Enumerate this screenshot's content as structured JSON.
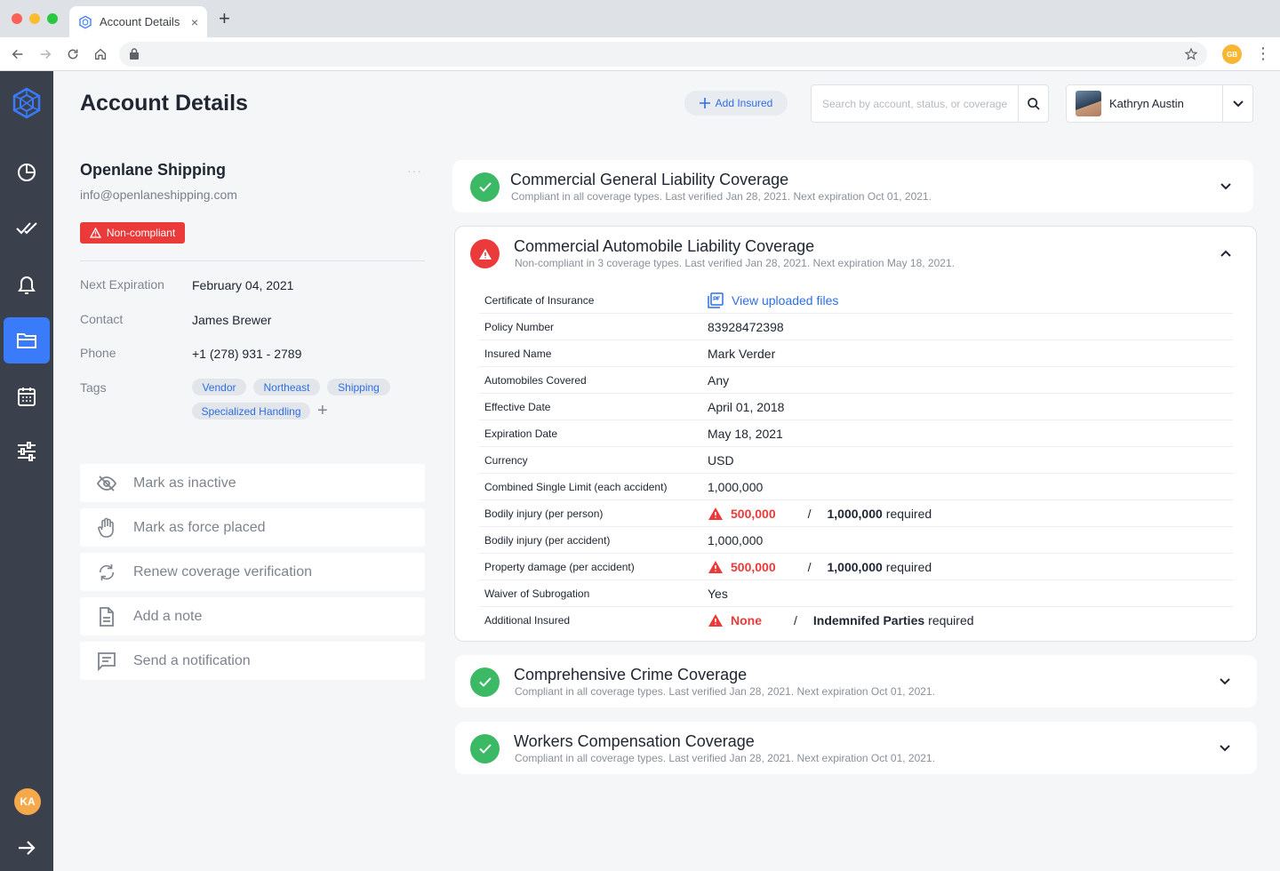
{
  "browser": {
    "tab_title": "Account Details",
    "new_tab": "+",
    "close_tab": "×",
    "ext_avatar": "GB"
  },
  "header": {
    "title": "Account Details",
    "add_insured_label": "Add Insured",
    "search_placeholder": "Search by account, status, or coverage",
    "user_name": "Kathryn Austin"
  },
  "sidebar": {
    "items": [
      "logo-icon",
      "dashboard-icon",
      "tasks-icon",
      "bell-icon",
      "folder-icon",
      "calendar-icon",
      "sliders-icon"
    ],
    "active_index": 4,
    "avatar_initials": "KA",
    "accent": "#3a7bfa"
  },
  "account": {
    "name": "Openlane Shipping",
    "email": "info@openlaneshipping.com",
    "status": "Non-compliant",
    "more": "···",
    "details": [
      {
        "label": "Next Expiration",
        "value": "February 04, 2021"
      },
      {
        "label": "Contact",
        "value": "James Brewer"
      },
      {
        "label": "Phone",
        "value": "+1 (278) 931 - 2789"
      }
    ],
    "tags_label": "Tags",
    "tags": [
      "Vendor",
      "Northeast",
      "Shipping",
      "Specialized Handling"
    ],
    "tag_add": "+"
  },
  "actions": [
    {
      "label": "Mark as inactive",
      "icon": "eye-off-icon"
    },
    {
      "label": "Mark as force placed",
      "icon": "hand-icon"
    },
    {
      "label": "Renew coverage verification",
      "icon": "refresh-icon"
    },
    {
      "label": "Add a note",
      "icon": "note-icon"
    },
    {
      "label": "Send a notification",
      "icon": "message-icon"
    }
  ],
  "coverages": [
    {
      "title": "Commercial General Liability Coverage",
      "subtitle": "Compliant in all coverage types. Last verified Jan 28, 2021. Next expiration Oct 01, 2021.",
      "status": "compliant"
    },
    {
      "title": "Commercial Automobile Liability Coverage",
      "subtitle": "Non-compliant in 3 coverage types. Last verified Jan 28, 2021. Next expiration May 18, 2021.",
      "status": "non-compliant"
    },
    {
      "title": "Comprehensive Crime Coverage",
      "subtitle": "Compliant in all coverage types. Last verified Jan 28, 2021. Next expiration Oct 01, 2021.",
      "status": "compliant"
    },
    {
      "title": "Workers Compensation Coverage",
      "subtitle": "Compliant in all coverage types. Last verified Jan 28, 2021. Next expiration Oct 01, 2021.",
      "status": "compliant"
    }
  ],
  "auto_details": {
    "rows": [
      {
        "label": "Certificate of Insurance",
        "value": "View uploaded files"
      },
      {
        "label": "Policy Number",
        "value": "83928472398"
      },
      {
        "label": "Insured Name",
        "value": "Mark Verder"
      },
      {
        "label": "Automobiles Covered",
        "value": "Any"
      },
      {
        "label": "Effective Date",
        "value": "April 01, 2018"
      },
      {
        "label": "Expiration Date",
        "value": "May 18, 2021"
      },
      {
        "label": "Currency",
        "value": "USD"
      },
      {
        "label": "Combined Single Limit (each accident)",
        "value": "1,000,000"
      },
      {
        "label": "Bodily injury (per person)",
        "value": "500,000",
        "required": "1,000,000"
      },
      {
        "label": "Bodily injury (per accident)",
        "value": "1,000,000"
      },
      {
        "label": "Property damage (per accident)",
        "value": "500,000",
        "required": "1,000,000"
      },
      {
        "label": "Waiver of Subrogation",
        "value": "Yes"
      },
      {
        "label": "Additional Insured",
        "value": "None",
        "required": "Indemnifed Parties"
      }
    ],
    "slash": "/",
    "required_suffix": "required"
  },
  "colors": {
    "error": "#ea3a3a",
    "success": "#3cb965",
    "link": "#2f6fe4"
  }
}
